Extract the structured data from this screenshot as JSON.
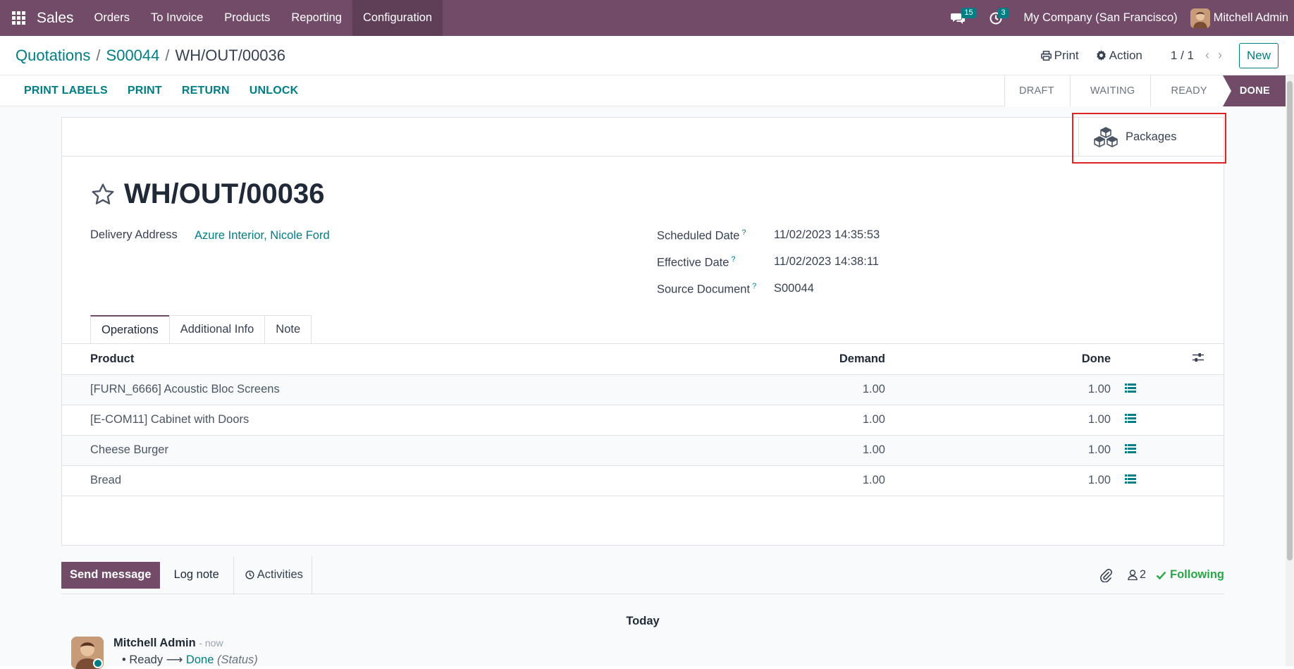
{
  "navbar": {
    "app_name": "Sales",
    "menu": [
      "Orders",
      "To Invoice",
      "Products",
      "Reporting",
      "Configuration"
    ],
    "messages_count": "15",
    "activities_count": "3",
    "company": "My Company (San Francisco)",
    "user": "Mitchell Admin",
    "icons": [
      "apps-grid-icon",
      "chat-icon",
      "clock-icon"
    ],
    "accent_color": "#714b67"
  },
  "breadcrumb": {
    "level1": "Quotations",
    "level2": "S00044",
    "current": "WH/OUT/00036",
    "separator": "/"
  },
  "control": {
    "print": "Print",
    "action": "Action",
    "pager": "1 / 1",
    "new": "New"
  },
  "statusbar": {
    "buttons": [
      "PRINT LABELS",
      "PRINT",
      "RETURN",
      "UNLOCK"
    ],
    "stages": [
      "DRAFT",
      "WAITING",
      "READY",
      "DONE"
    ],
    "current_stage": "DONE"
  },
  "smart_button": {
    "packages": "Packages"
  },
  "record": {
    "title": "WH/OUT/00036",
    "delivery_address_label": "Delivery Address",
    "delivery_address": "Azure Interior, Nicole Ford",
    "scheduled_date_label": "Scheduled Date",
    "scheduled_date": "11/02/2023 14:35:53",
    "effective_date_label": "Effective Date",
    "effective_date": "11/02/2023 14:38:11",
    "source_document_label": "Source Document",
    "source_document": "S00044",
    "help_mark": "?"
  },
  "tabs": [
    "Operations",
    "Additional Info",
    "Note"
  ],
  "operations": {
    "columns": {
      "product": "Product",
      "demand": "Demand",
      "done": "Done"
    },
    "rows": [
      {
        "product": "[FURN_6666] Acoustic Bloc Screens",
        "demand": "1.00",
        "done": "1.00"
      },
      {
        "product": "[E-COM11] Cabinet with Doors",
        "demand": "1.00",
        "done": "1.00"
      },
      {
        "product": "Cheese Burger",
        "demand": "1.00",
        "done": "1.00"
      },
      {
        "product": "Bread",
        "demand": "1.00",
        "done": "1.00"
      }
    ]
  },
  "chatter": {
    "send_message": "Send message",
    "log_note": "Log note",
    "activities": "Activities",
    "followers_count": "2",
    "following": "Following",
    "today": "Today",
    "message": {
      "author": "Mitchell Admin",
      "time": "- now",
      "old_value": "Ready",
      "arrow": "⟶",
      "new_value": "Done",
      "field": "(Status)"
    }
  }
}
